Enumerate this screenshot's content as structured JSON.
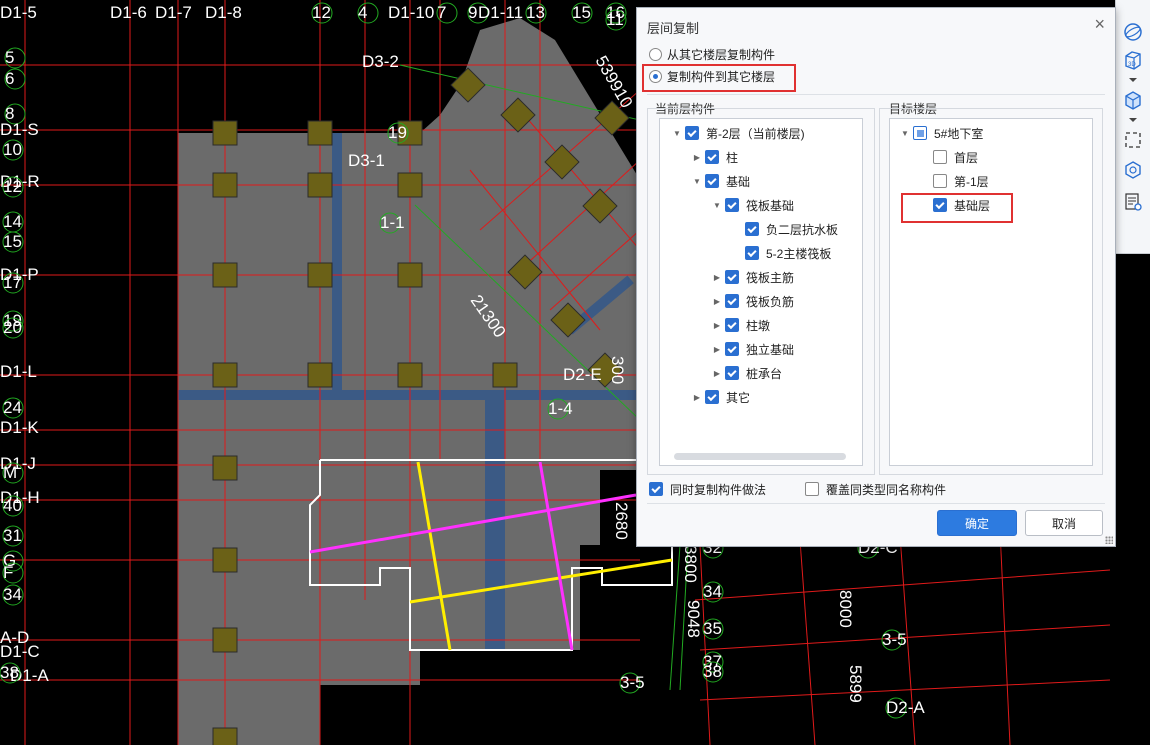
{
  "cad": {
    "labels": [
      {
        "text": "D1-5"
      },
      {
        "text": "D1-6"
      },
      {
        "text": "D1-7"
      },
      {
        "text": "D1-8"
      },
      {
        "text": "12"
      },
      {
        "text": "4"
      },
      {
        "text": "D1-10"
      },
      {
        "text": "7"
      },
      {
        "text": "9"
      },
      {
        "text": "D1-11"
      },
      {
        "text": "13"
      },
      {
        "text": "15"
      },
      {
        "text": "16"
      },
      {
        "text": "11"
      },
      {
        "text": "5"
      },
      {
        "text": "6"
      },
      {
        "text": "8"
      },
      {
        "text": "D1-S"
      },
      {
        "text": "10"
      },
      {
        "text": "D1-R"
      },
      {
        "text": "12"
      },
      {
        "text": "14"
      },
      {
        "text": "15"
      },
      {
        "text": "D1-P"
      },
      {
        "text": "17"
      },
      {
        "text": "19"
      },
      {
        "text": "20"
      },
      {
        "text": "D1-L"
      },
      {
        "text": "24"
      },
      {
        "text": "D1-K"
      },
      {
        "text": "D1-J"
      },
      {
        "text": "M"
      },
      {
        "text": "D1-H"
      },
      {
        "text": "40"
      },
      {
        "text": "31"
      },
      {
        "text": "G"
      },
      {
        "text": "F"
      },
      {
        "text": "34"
      },
      {
        "text": "A-D"
      },
      {
        "text": "D1-C"
      },
      {
        "text": "D1-A"
      },
      {
        "text": "38"
      },
      {
        "text": "D3-2"
      },
      {
        "text": "19"
      },
      {
        "text": "D3-1"
      },
      {
        "text": "1-1"
      },
      {
        "text": "D2-E"
      },
      {
        "text": "1-4"
      },
      {
        "text": "21300"
      },
      {
        "text": "539910"
      },
      {
        "text": "300"
      },
      {
        "text": "2680"
      },
      {
        "text": "32"
      },
      {
        "text": "34"
      },
      {
        "text": "35"
      },
      {
        "text": "37"
      },
      {
        "text": "38"
      },
      {
        "text": "3-5"
      },
      {
        "text": "3-5"
      },
      {
        "text": "D2-C"
      },
      {
        "text": "D2-A"
      },
      {
        "text": "8000"
      },
      {
        "text": "5899"
      },
      {
        "text": "3800"
      },
      {
        "text": "9048"
      }
    ]
  },
  "toolbar": {
    "items": [
      "sphere-icon",
      "3d-view-icon",
      "cube-icon",
      "dashed-frame-icon",
      "component-view-icon",
      "properties-list-icon"
    ]
  },
  "dialog": {
    "title": "层间复制",
    "close_glyph": "×",
    "radio_from": "从其它楼层复制构件",
    "radio_to": "复制构件到其它楼层",
    "left_group": "当前层构件",
    "right_group": "目标楼层",
    "left_tree": [
      {
        "label": "第-2层（当前楼层)"
      },
      {
        "label": "柱"
      },
      {
        "label": "基础"
      },
      {
        "label": "筏板基础"
      },
      {
        "label": "负二层抗水板"
      },
      {
        "label": "5-2主楼筏板"
      },
      {
        "label": "筏板主筋"
      },
      {
        "label": "筏板负筋"
      },
      {
        "label": "柱墩"
      },
      {
        "label": "独立基础"
      },
      {
        "label": "桩承台"
      },
      {
        "label": "其它"
      }
    ],
    "right_tree": [
      {
        "label": "5#地下室"
      },
      {
        "label": "首层"
      },
      {
        "label": "第-1层"
      },
      {
        "label": "基础层"
      }
    ],
    "opt_copy_method": "同时复制构件做法",
    "opt_overwrite": "覆盖同类型同名称构件",
    "ok": "确定",
    "cancel": "取消",
    "colors": {
      "accent": "#2d7be0",
      "highlight": "#e03131"
    }
  }
}
